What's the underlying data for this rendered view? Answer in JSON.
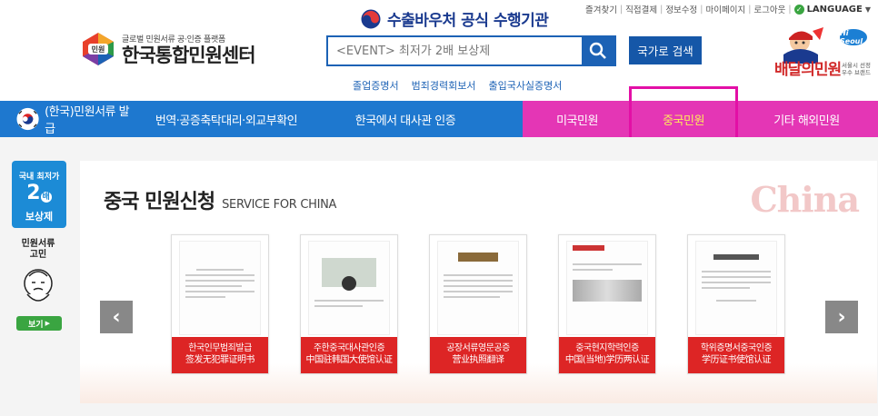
{
  "util_links": [
    "즐겨찾기",
    "직접결제",
    "정보수정",
    "마이페이지",
    "로그아웃"
  ],
  "language_label": "LANGUAGE",
  "logo": {
    "subtitle": "글로벌 민원서류 공·인증 플랫폼",
    "title": "한국통합민원센터",
    "mark_text": "민원"
  },
  "voucher_text": "수출바우처 공식 수행기관",
  "search": {
    "placeholder": "<EVENT> 최저가 2배 보상제",
    "country_button": "국가로 검색"
  },
  "quick_links": [
    "졸업증명서",
    "범죄경력회보서",
    "출입국사실증명서"
  ],
  "brand": {
    "name": "배달의민원",
    "badge": "Hi Seoul",
    "sub": "서울시 선정\n우수 브랜드"
  },
  "nav": [
    {
      "label": "(한국)민원서류 발급",
      "active": false
    },
    {
      "label": "번역·공증축탁대리·외교부확인",
      "active": false
    },
    {
      "label": "한국에서 대사관 인증",
      "active": false
    },
    {
      "label": "미국민원",
      "active": false
    },
    {
      "label": "중국민원",
      "active": true
    },
    {
      "label": "기타 해외민원",
      "active": false
    }
  ],
  "section": {
    "title": "중국 민원신청",
    "subtitle": "SERVICE FOR CHINA",
    "deco": "China"
  },
  "cards": [
    {
      "label_ko": "한국인무범죄발급",
      "label_cn": "签发无犯罪证明书"
    },
    {
      "label_ko": "주한중국대사관인증",
      "label_cn": "中国驻韩国大使馆认证"
    },
    {
      "label_ko": "공장서류영문공증",
      "label_cn": "营业执照翻译"
    },
    {
      "label_ko": "중국현지학력인증",
      "label_cn": "中国(当地)学历两认证"
    },
    {
      "label_ko": "학위증명서중국인증",
      "label_cn": "学历证书使馆认证"
    }
  ],
  "side": {
    "badge_top": "국내 최저가",
    "badge_num": "2",
    "badge_unit": "배",
    "badge_bottom": "보상제",
    "text": "민원서류\n고민",
    "button": "보기"
  },
  "arrows": {
    "left": "‹",
    "right": "›"
  },
  "colors": {
    "nav_blue": "#1e78cf",
    "nav_pink": "#e436b5",
    "active_text": "#ffe95c",
    "card_label": "#dd2525",
    "search_border": "#1c62b5"
  }
}
